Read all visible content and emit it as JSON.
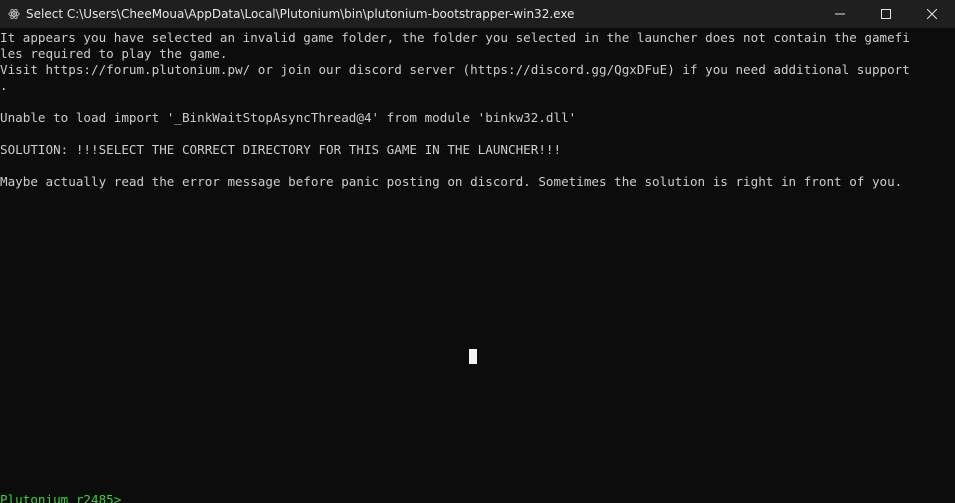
{
  "window": {
    "title": "Select C:\\Users\\CheeMoua\\AppData\\Local\\Plutonium\\bin\\plutonium-bootstrapper-win32.exe",
    "app_icon": "plutonium-atom-icon",
    "controls": [
      "minimize-icon",
      "maximize-icon",
      "close-icon"
    ]
  },
  "console": {
    "lines": [
      "It appears you have selected an invalid game folder, the folder you selected in the launcher does not contain the gamefi",
      "les required to play the game.",
      "Visit https://forum.plutonium.pw/ or join our discord server (https://discord.gg/QgxDFuE) if you need additional support",
      ".",
      "",
      "Unable to load import '_BinkWaitStopAsyncThread@4' from module 'binkw32.dll'",
      "",
      "SOLUTION: !!!SELECT THE CORRECT DIRECTORY FOR THIS GAME IN THE LAUNCHER!!!",
      "",
      "Maybe actually read the error message before panic posting on discord. Sometimes the solution is right in front of you."
    ],
    "prompt": "Plutonium r2485>"
  },
  "colors": {
    "background": "#0c0c0c",
    "titlebar": "#1f1f1f",
    "text": "#cccccc",
    "prompt": "#3fd13f"
  }
}
